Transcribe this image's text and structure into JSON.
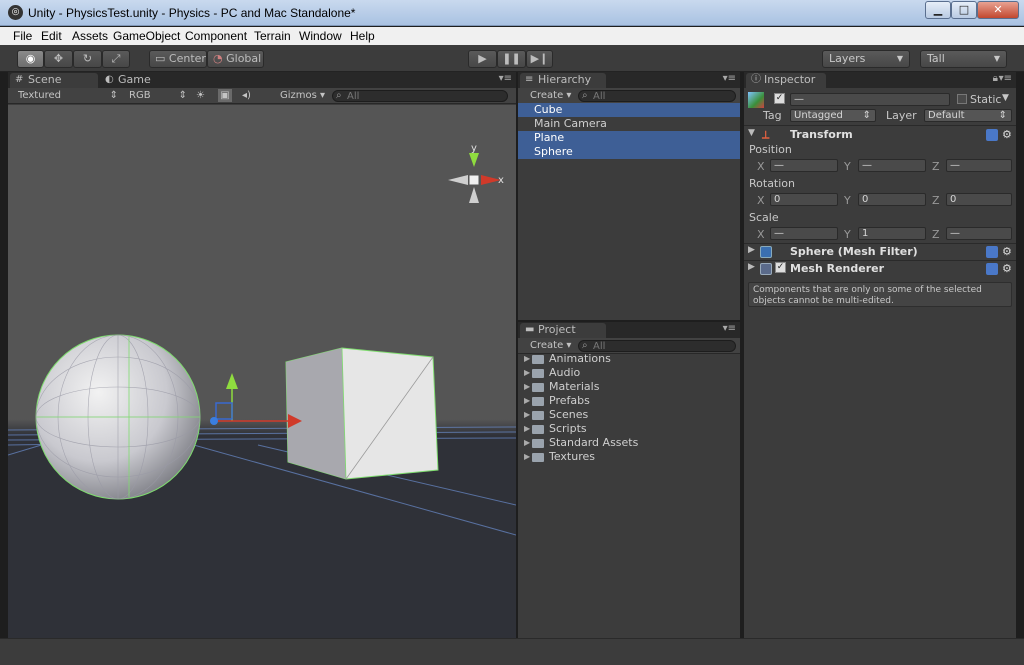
{
  "window": {
    "title": "Unity - PhysicsTest.unity - Physics - PC and Mac Standalone*",
    "app_icon": "unity-logo-icon",
    "controls": [
      "minimize",
      "maximize",
      "close"
    ]
  },
  "menu": [
    "File",
    "Edit",
    "Assets",
    "GameObject",
    "Component",
    "Terrain",
    "Window",
    "Help"
  ],
  "toolbar": {
    "tools": [
      "view-eye-icon",
      "move-icon",
      "rotate-icon",
      "scale-icon"
    ],
    "pivot": "Center",
    "space": "Global",
    "play_controls": [
      "play-icon",
      "pause-icon",
      "step-icon"
    ],
    "layers": "Layers",
    "layout": "Tall"
  },
  "scene_panel": {
    "tabs": [
      "Scene",
      "Game"
    ],
    "render_mode": "Textured",
    "color_mode": "RGB",
    "gizmos": "Gizmos",
    "search_placeholder": "All",
    "axis_labels": {
      "y": "y",
      "x": "x"
    }
  },
  "hierarchy": {
    "tab": "Hierarchy",
    "create": "Create",
    "search_placeholder": "All",
    "items": [
      {
        "label": "Cube",
        "selected": true
      },
      {
        "label": "Main Camera",
        "selected": false
      },
      {
        "label": "Plane",
        "selected": true
      },
      {
        "label": "Sphere",
        "selected": true
      }
    ]
  },
  "project": {
    "tab": "Project",
    "create": "Create",
    "search_placeholder": "All",
    "folders": [
      "Animations",
      "Audio",
      "Materials",
      "Prefabs",
      "Scenes",
      "Scripts",
      "Standard Assets",
      "Textures"
    ]
  },
  "inspector": {
    "tab": "Inspector",
    "name_value": "—",
    "static_label": "Static",
    "tag_label": "Tag",
    "tag_value": "Untagged",
    "layer_label": "Layer",
    "layer_value": "Default",
    "transform": {
      "title": "Transform",
      "position_label": "Position",
      "rotation_label": "Rotation",
      "scale_label": "Scale",
      "position": {
        "x": "—",
        "y": "—",
        "z": "—"
      },
      "rotation": {
        "x": "0",
        "y": "0",
        "z": "0"
      },
      "scale": {
        "x": "—",
        "y": "1",
        "z": "—"
      },
      "axis_x": "X",
      "axis_y": "Y",
      "axis_z": "Z"
    },
    "components": [
      {
        "title": "Sphere (Mesh Filter)"
      },
      {
        "title": "Mesh Renderer"
      }
    ],
    "note": "Components that are only on some of the selected objects cannot be multi-edited."
  },
  "colors": {
    "selection": "#3e5f96",
    "panel": "#3c3c3c",
    "viewport_top": "#545454",
    "viewport_bottom": "#2f3138"
  }
}
